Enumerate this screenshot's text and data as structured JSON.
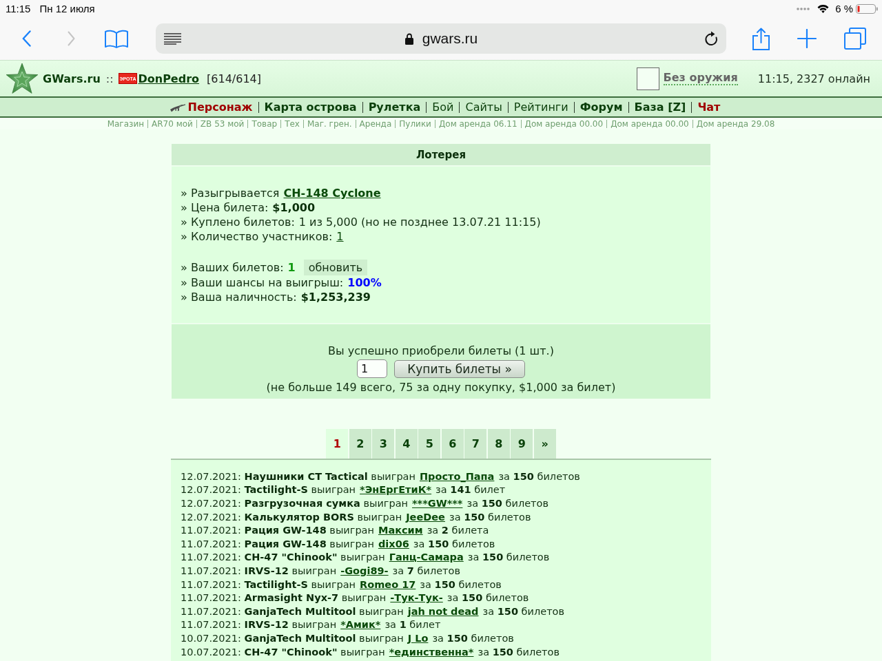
{
  "status_bar": {
    "time": "11:15",
    "date": "Пн 12 июля",
    "battery": "6 %"
  },
  "browser": {
    "url": "gwars.ru"
  },
  "site_header": {
    "site_name": "GWars.ru",
    "separator": "::",
    "clan_tag": "ЭРОТА",
    "player": "DonPedro",
    "hp": "[614/614]",
    "weapon": "Без оружия",
    "online": "11:15, 2327 онлайн"
  },
  "main_nav": [
    {
      "label": "Персонаж",
      "kind": "armed"
    },
    {
      "label": "Карта острова",
      "kind": "bold"
    },
    {
      "label": "Рулетка",
      "kind": "bold"
    },
    {
      "label": "Бой",
      "kind": "plain"
    },
    {
      "label": "Сайты",
      "kind": "plain"
    },
    {
      "label": "Рейтинги",
      "kind": "plain"
    },
    {
      "label": "Форум",
      "kind": "bold"
    },
    {
      "label": "База [Z]",
      "kind": "bold"
    },
    {
      "label": "Чат",
      "kind": "accent"
    }
  ],
  "sub_nav": [
    "Магазин",
    "AR70 мой",
    "ZB 53 мой",
    "Товар",
    "Тех",
    "Маг. грен.",
    "Аренда",
    "Пулики",
    "Дом аренда 06.11",
    "Дом аренда 00.00",
    "Дом аренда 00.00",
    "Дом аренда 29.08"
  ],
  "lottery": {
    "title": "Лотерея",
    "info_groups": [
      [
        {
          "label": "» Разыгрывается",
          "value": "CH-148 Cyclone",
          "kind": "link"
        },
        {
          "label": "» Цена билета:",
          "value": "$1,000",
          "kind": "bold"
        },
        {
          "label": "» Куплено билетов:",
          "value": "1 из 5,000 (но не позднее 13.07.21 11:15)",
          "kind": "plain"
        },
        {
          "label": "» Количество участников:",
          "value": "1",
          "kind": "underline"
        }
      ],
      [
        {
          "label": "» Ваших билетов:",
          "value": "1",
          "kind": "count",
          "button": "обновить"
        },
        {
          "label": "» Ваши шансы на выигрыш:",
          "value": "100%",
          "kind": "percent"
        },
        {
          "label": "» Ваша наличность:",
          "value": "$1,253,239",
          "kind": "bold"
        }
      ]
    ],
    "purchase": {
      "message": "Вы успешно приобрели билеты (1 шт.)",
      "quantity": "1",
      "buy_button": "Купить билеты »",
      "note": "(не больше 149 всего, 75 за одну покупку, $1,000 за билет)"
    }
  },
  "pagination": [
    {
      "label": "1",
      "selected": true
    },
    {
      "label": "2",
      "selected": false
    },
    {
      "label": "3",
      "selected": false
    },
    {
      "label": "4",
      "selected": false
    },
    {
      "label": "5",
      "selected": false
    },
    {
      "label": "6",
      "selected": false
    },
    {
      "label": "7",
      "selected": false
    },
    {
      "label": "8",
      "selected": false
    },
    {
      "label": "9",
      "selected": false
    },
    {
      "label": "»",
      "selected": false
    }
  ],
  "results": [
    {
      "before": "12.07.2021: **Наушники CT Tactical** выигран",
      "winner": "Просто_Папа",
      "after": "за **150** билетов"
    },
    {
      "before": "12.07.2021: **Tactilight-S** выигран",
      "winner": "*ЭнЕргЕтиК*",
      "after": "за **141** билет"
    },
    {
      "before": "12.07.2021: **Разгрузочная сумка** выигран",
      "winner": "***GW***",
      "after": "за **150** билетов"
    },
    {
      "before": "12.07.2021: **Калькулятор BORS** выигран",
      "winner": "JeeDee",
      "after": "за **150** билетов"
    },
    {
      "before": "11.07.2021: **Рация GW-148** выигран",
      "winner": "Максим",
      "after": "за **2** билета"
    },
    {
      "before": "11.07.2021: **Рация GW-148** выигран",
      "winner": "dix06",
      "after": "за **150** билетов"
    },
    {
      "before": "11.07.2021: **CH-47 \"Chinook\"** выигран",
      "winner": "Ганц-Самара",
      "after": "за **150** билетов"
    },
    {
      "before": "11.07.2021: **IRVS-12** выигран",
      "winner": "-Gogi89-",
      "after": "за **7** билетов"
    },
    {
      "before": "11.07.2021: **Tactilight-S** выигран",
      "winner": "Romeo 17",
      "after": "за **150** билетов"
    },
    {
      "before": "11.07.2021: **Armasight Nyx-7** выигран",
      "winner": "-Тук-Тук-",
      "after": "за **150** билетов"
    },
    {
      "before": "11.07.2021: **GanjaTech Multitool** выигран",
      "winner": "jah not dead",
      "after": "за **150** билетов"
    },
    {
      "before": "11.07.2021: **IRVS-12** выигран",
      "winner": "*Амик*",
      "after": "за **1** билет"
    },
    {
      "before": "10.07.2021: **GanjaTech Multitool** выигран",
      "winner": "J Lo",
      "after": "за **150** билетов"
    },
    {
      "before": "10.07.2021: **CH-47 \"Chinook\"** выигран",
      "winner": "*единственна*",
      "after": "за **150** билетов"
    }
  ]
}
